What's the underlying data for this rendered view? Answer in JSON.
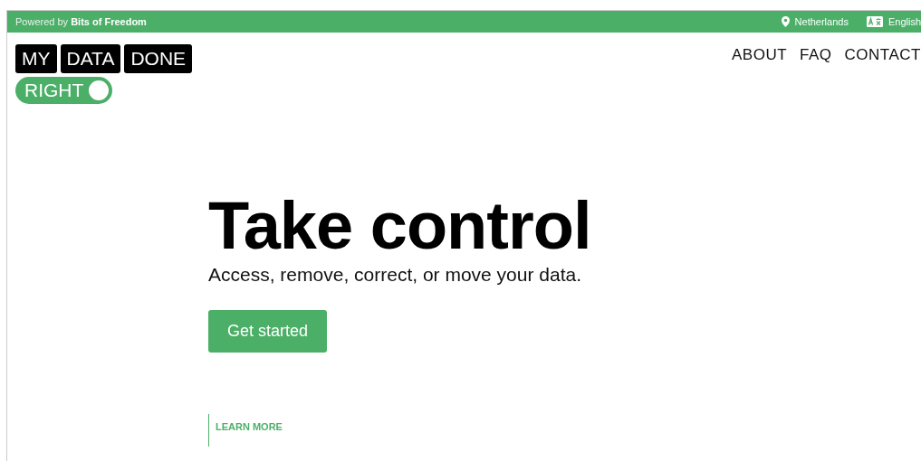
{
  "top_bar": {
    "powered_by": "Powered by **Bits of Freedom**",
    "location": "Netherlands",
    "language": "English"
  },
  "logo": {
    "words": [
      "MY",
      "DATA",
      "DONE"
    ],
    "toggle_word": "RIGHT"
  },
  "nav": [
    "ABOUT",
    "FAQ",
    "CONTACT"
  ],
  "hero": {
    "title": "Take control",
    "subtitle": "Access, remove, correct, or move your data.",
    "button": "Get started",
    "learn_more": "LEARN MORE"
  }
}
